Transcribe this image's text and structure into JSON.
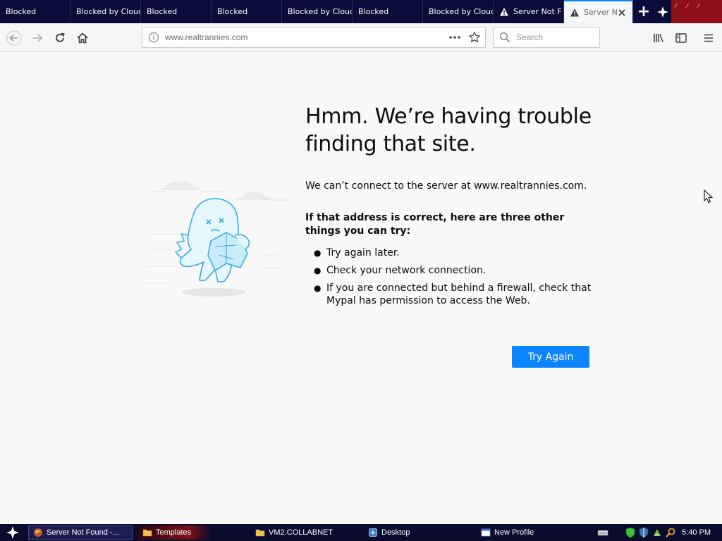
{
  "browser": {
    "tabs": [
      {
        "label": "Blocked",
        "selected": false,
        "has_warning_icon": false
      },
      {
        "label": "Blocked by Cloud",
        "selected": false,
        "has_warning_icon": false
      },
      {
        "label": "Blocked",
        "selected": false,
        "has_warning_icon": false
      },
      {
        "label": "Blocked",
        "selected": false,
        "has_warning_icon": false
      },
      {
        "label": "Blocked by Cloud",
        "selected": false,
        "has_warning_icon": false
      },
      {
        "label": "Blocked",
        "selected": false,
        "has_warning_icon": false
      },
      {
        "label": "Blocked by Cloud",
        "selected": false,
        "has_warning_icon": false
      },
      {
        "label": "Server Not F",
        "selected": false,
        "has_warning_icon": true
      },
      {
        "label": "Server N",
        "selected": true,
        "has_warning_icon": true
      }
    ],
    "new_tab_glyph": "+",
    "toolbar": {
      "icons": [
        "back-arrow-icon",
        "forward-arrow-icon",
        "reload-icon",
        "home-icon",
        "library-icon",
        "sidebar-icon",
        "hamburger-menu-icon"
      ]
    },
    "urlbar": {
      "url": "www.realtrannies.com"
    },
    "searchbar": {
      "placeholder": "Search"
    }
  },
  "error_page": {
    "title": "Hmm. We’re having trouble finding that site.",
    "description": "We can’t connect to the server at www.realtrannies.com.",
    "subtitle": "If that address is correct, here are three other things you can try:",
    "suggestions": [
      "Try again later.",
      "Check your network connection.",
      "If you are connected but behind a firewall, check that Mypal has permission to access the Web."
    ],
    "button_label": "Try Again",
    "accent_color": "#0a84ff"
  },
  "taskbar": {
    "tasks": [
      {
        "label": "Server Not Found -...",
        "icon": "browser-icon",
        "active": true
      },
      {
        "label": "Templates",
        "icon": "folder-icon",
        "active": false
      },
      {
        "label": "VM2.COLLABNET",
        "icon": "folder-icon",
        "active": false
      },
      {
        "label": "Desktop",
        "icon": "desktop-icon",
        "active": false
      },
      {
        "label": "New Profile",
        "icon": "window-icon",
        "active": false
      }
    ],
    "clock": "5:40 PM"
  }
}
